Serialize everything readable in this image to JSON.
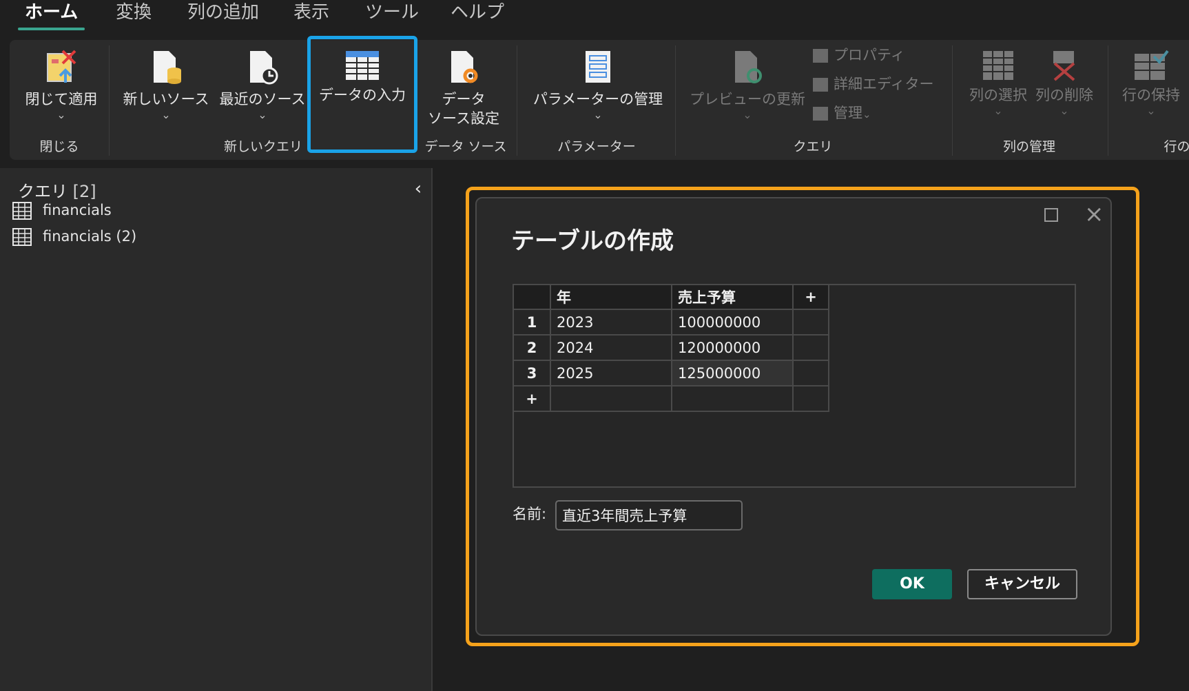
{
  "menu": {
    "tabs": [
      "ホーム",
      "変換",
      "列の追加",
      "表示",
      "ツール",
      "ヘルプ"
    ]
  },
  "ribbon": {
    "close_apply": "閉じて適用",
    "new_source": "新しいソース",
    "recent_sources": "最近のソース",
    "enter_data": "データの入力",
    "data_source_settings_1": "データ",
    "data_source_settings_2": "ソース設定",
    "manage_parameters": "パラメーターの管理",
    "refresh_preview": "プレビューの更新",
    "properties": "プロパティ",
    "advanced_editor": "詳細エディター",
    "manage": "管理",
    "choose_columns": "列の選択",
    "remove_columns": "列の削除",
    "keep_rows": "行の保持",
    "groups": {
      "close": "閉じる",
      "new_query": "新しいクエリ",
      "data_sources": "データ ソース",
      "parameters": "パラメーター",
      "query": "クエリ",
      "manage_columns": "列の管理",
      "reduce_rows": "行の削"
    }
  },
  "queries_pane": {
    "title": "クエリ",
    "count": "[2]",
    "items": [
      "financials",
      "financials (2)"
    ]
  },
  "dialog": {
    "title": "テーブルの作成",
    "columns": [
      "年",
      "売上予算"
    ],
    "add_column": "+",
    "rows": [
      {
        "num": "1",
        "year": "2023",
        "budget": "100000000"
      },
      {
        "num": "2",
        "year": "2024",
        "budget": "120000000"
      },
      {
        "num": "3",
        "year": "2025",
        "budget": "125000000"
      }
    ],
    "add_row": "+",
    "name_label": "名前:",
    "name_value": "直近3年間売上予算",
    "ok": "OK",
    "cancel": "キャンセル"
  },
  "colors": {
    "accent_tab": "#3aa58f",
    "highlight_blue": "#1aa3e8",
    "highlight_orange": "#f5a21b",
    "ok_button": "#0e6e5f"
  }
}
